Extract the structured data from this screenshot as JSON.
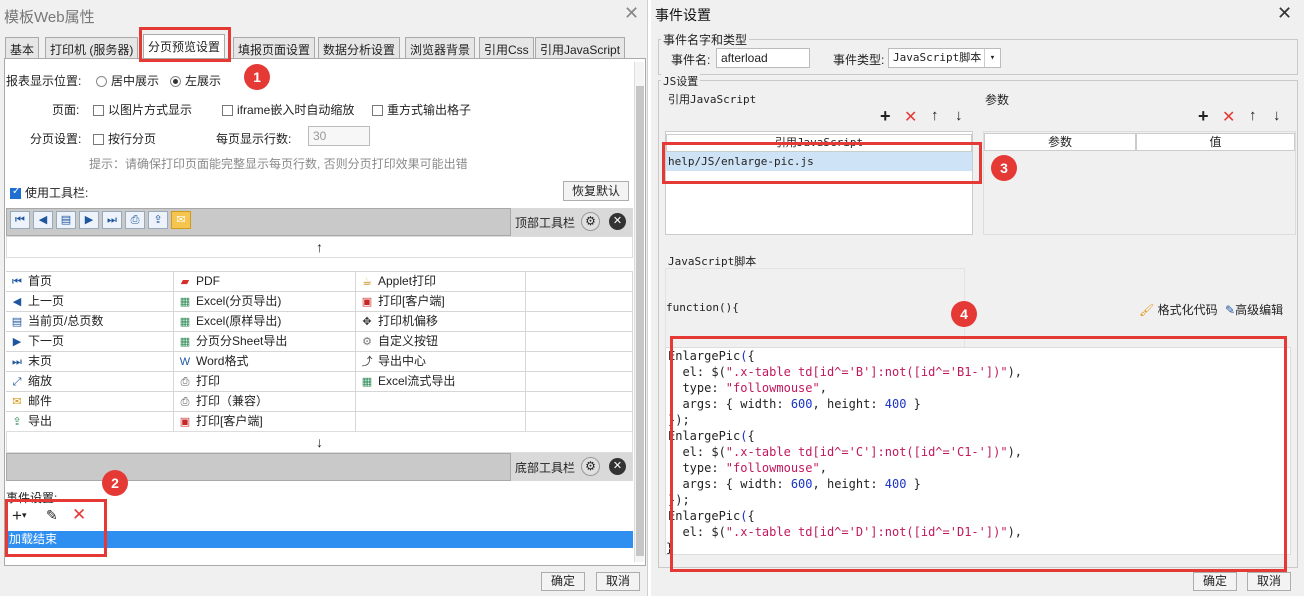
{
  "left": {
    "title": "模板Web属性",
    "tabs": [
      "基本",
      "打印机 (服务器)",
      "分页预览设置",
      "填报页面设置",
      "数据分析设置",
      "浏览器背景",
      "引用Css",
      "引用JavaScript"
    ],
    "report_pos_label": "报表显示位置:",
    "radio_center": "居中展示",
    "radio_left": "左展示",
    "page_label": "页面:",
    "cb_image": "以图片方式显示",
    "cb_iframe": "iframe嵌入时自动缩放",
    "cb_repeat": "重方式输出格子",
    "paging_label": "分页设置:",
    "cb_row_paging": "按行分页",
    "rows_per_page_label": "每页显示行数:",
    "rows_per_page": "30",
    "hint": "提示：请确保打印页面能完整显示每页行数, 否则分页打印效果可能出错",
    "use_toolbar": "使用工具栏:",
    "restore_default": "恢复默认",
    "top_toolbar": "顶部工具栏",
    "bottom_toolbar": "底部工具栏",
    "up_arrow": "↑",
    "down_arrow": "↓",
    "grid": [
      [
        "首页",
        "PDF",
        "Applet打印"
      ],
      [
        "上一页",
        "Excel(分页导出)",
        "打印[客户端]"
      ],
      [
        "当前页/总页数",
        "Excel(原样导出)",
        "打印机偏移"
      ],
      [
        "下一页",
        "分页分Sheet导出",
        "自定义按钮"
      ],
      [
        "末页",
        "Word格式",
        "导出中心"
      ],
      [
        "缩放",
        "打印",
        "Excel流式导出"
      ],
      [
        "邮件",
        "打印（兼容）",
        ""
      ],
      [
        "导出",
        "打印[客户端]",
        ""
      ]
    ],
    "grid_icons": [
      [
        "first-page-icon",
        "pdf-icon",
        "applet-print-icon"
      ],
      [
        "prev-page-icon",
        "excel-icon",
        "print-client-icon"
      ],
      [
        "page-count-icon",
        "excel-icon",
        "printer-offset-icon"
      ],
      [
        "next-page-icon",
        "excel-icon",
        "custom-button-icon"
      ],
      [
        "last-page-icon",
        "word-icon",
        "export-center-icon"
      ],
      [
        "zoom-icon",
        "print-icon",
        "excel-stream-icon"
      ],
      [
        "mail-icon",
        "print-compat-icon",
        ""
      ],
      [
        "export-icon",
        "print-client-icon",
        ""
      ]
    ],
    "event_label": "事件设置:",
    "event_item": "加载结束",
    "ok": "确定",
    "cancel": "取消"
  },
  "right": {
    "title": "事件设置",
    "name_type_group": "事件名字和类型",
    "event_name_label": "事件名:",
    "event_name": "afterload",
    "event_type_label": "事件类型:",
    "event_type": "JavaScript脚本",
    "js_group": "JS设置",
    "ref_js_label": "引用JavaScript",
    "params_label": "参数",
    "ref_js_header": "引用JavaScript",
    "ref_js_item": "help/JS/enlarge-pic.js",
    "param_col": "参数",
    "value_col": "值",
    "script_label": "JavaScript脚本",
    "func_header": "function(){",
    "format_code": "格式化代码",
    "advanced_edit": "高级编辑",
    "code_lines": [
      "EnlargePic({",
      "  el: $(\".x-table td[id^='B']:not([id^='B1-'])\"),",
      "  type: \"followmouse\",",
      "  args: { width: 600, height: 400 }",
      "});",
      "EnlargePic({",
      "  el: $(\".x-table td[id^='C']:not([id^='C1-'])\"),",
      "  type: \"followmouse\",",
      "  args: { width: 600, height: 400 }",
      "});",
      "EnlargePic({",
      "  el: $(\".x-table td[id^='D']:not([id^='D1-'])\"),"
    ],
    "closing_brace": "}",
    "ok": "确定",
    "cancel": "取消"
  },
  "badges": [
    "1",
    "2",
    "3",
    "4"
  ],
  "colors": {
    "annotation_red": "#e53935",
    "selection_blue": "#2f8ff0"
  }
}
